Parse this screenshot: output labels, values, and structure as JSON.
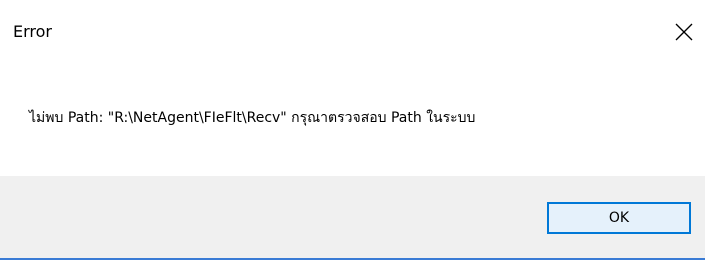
{
  "window": {
    "title": "Error",
    "close_icon": "close-icon"
  },
  "message": {
    "text": "ไม่พบ Path: \"R:\\NetAgent\\FIeFlt\\Recv\" กรุณาตรวจสอบ Path ในระบบ"
  },
  "buttons": {
    "ok_label": "OK"
  },
  "colors": {
    "footer_bg": "#f0f0f0",
    "button_border": "#0078d7",
    "button_bg": "#e5f1fb",
    "accent_line": "#3a7bd5"
  }
}
